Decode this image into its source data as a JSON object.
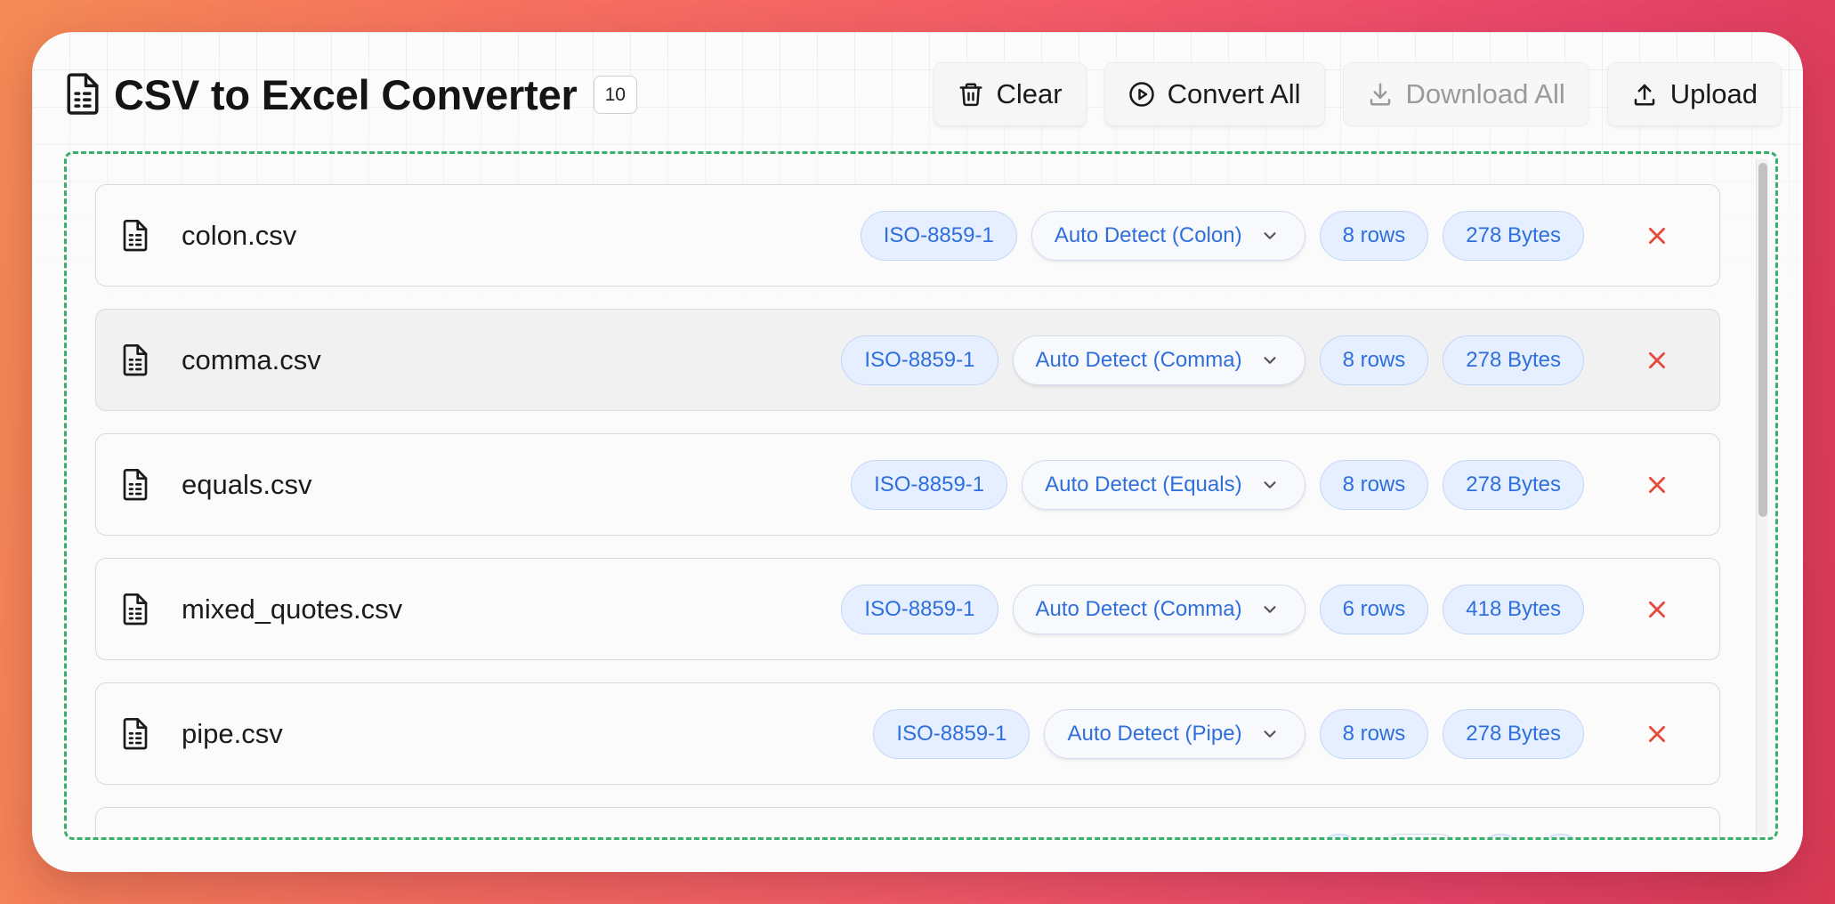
{
  "header": {
    "title": "CSV to Excel Converter",
    "file_count": "10"
  },
  "toolbar": {
    "clear_label": "Clear",
    "convert_all_label": "Convert All",
    "download_all_label": "Download All",
    "upload_label": "Upload",
    "download_all_disabled": true
  },
  "files": [
    {
      "name": "colon.csv",
      "encoding": "ISO-8859-1",
      "delimiter": "Auto Detect (Colon)",
      "rows": "8 rows",
      "size": "278 Bytes"
    },
    {
      "name": "comma.csv",
      "encoding": "ISO-8859-1",
      "delimiter": "Auto Detect (Comma)",
      "rows": "8 rows",
      "size": "278 Bytes"
    },
    {
      "name": "equals.csv",
      "encoding": "ISO-8859-1",
      "delimiter": "Auto Detect (Equals)",
      "rows": "8 rows",
      "size": "278 Bytes"
    },
    {
      "name": "mixed_quotes.csv",
      "encoding": "ISO-8859-1",
      "delimiter": "Auto Detect (Comma)",
      "rows": "6 rows",
      "size": "418 Bytes"
    },
    {
      "name": "pipe.csv",
      "encoding": "ISO-8859-1",
      "delimiter": "Auto Detect (Pipe)",
      "rows": "8 rows",
      "size": "278 Bytes"
    },
    {
      "name": "",
      "encoding": "",
      "delimiter": "",
      "rows": "",
      "size": ""
    }
  ],
  "colors": {
    "accent_blue": "#2f6fdb",
    "pill_bg": "#e6efff",
    "remove_red": "#e5483c",
    "dropzone_green": "#36b06c"
  },
  "icons": {
    "title": "file-spreadsheet-icon",
    "clear": "trash-icon",
    "convert": "play-circle-icon",
    "download": "download-icon",
    "upload": "upload-icon",
    "row_file": "file-spreadsheet-icon",
    "select": "chevron-down-icon",
    "remove": "close-icon"
  }
}
